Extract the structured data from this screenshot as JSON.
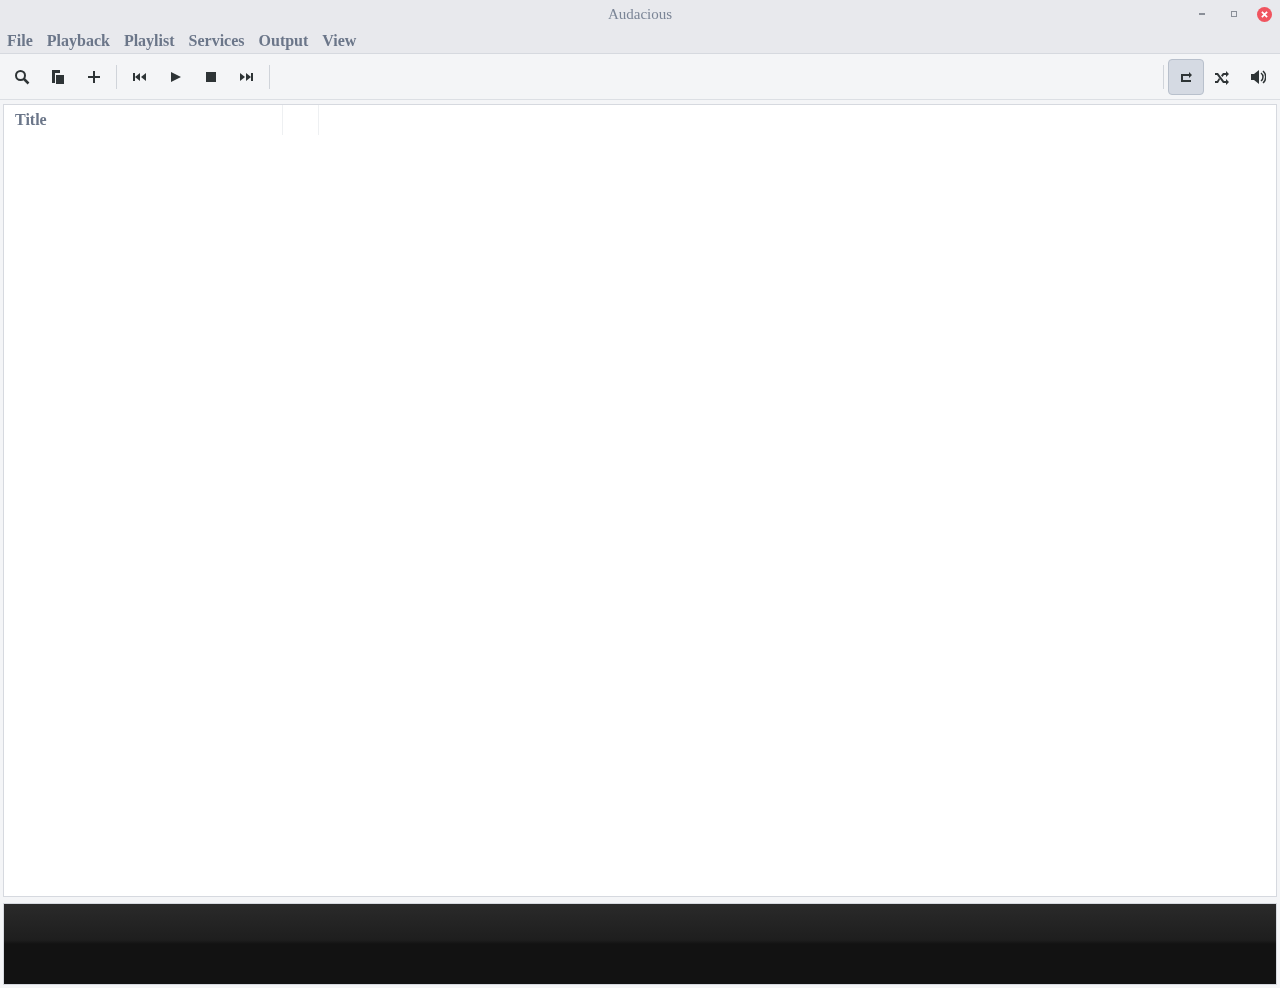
{
  "window": {
    "title": "Audacious"
  },
  "menu": [
    "File",
    "Playback",
    "Playlist",
    "Services",
    "Output",
    "View"
  ],
  "toggles": [
    {
      "kind": "repeat",
      "selected": true
    },
    {
      "kind": "shuffle",
      "selected": false
    }
  ],
  "playlist": {
    "columns": [
      "Title"
    ]
  }
}
